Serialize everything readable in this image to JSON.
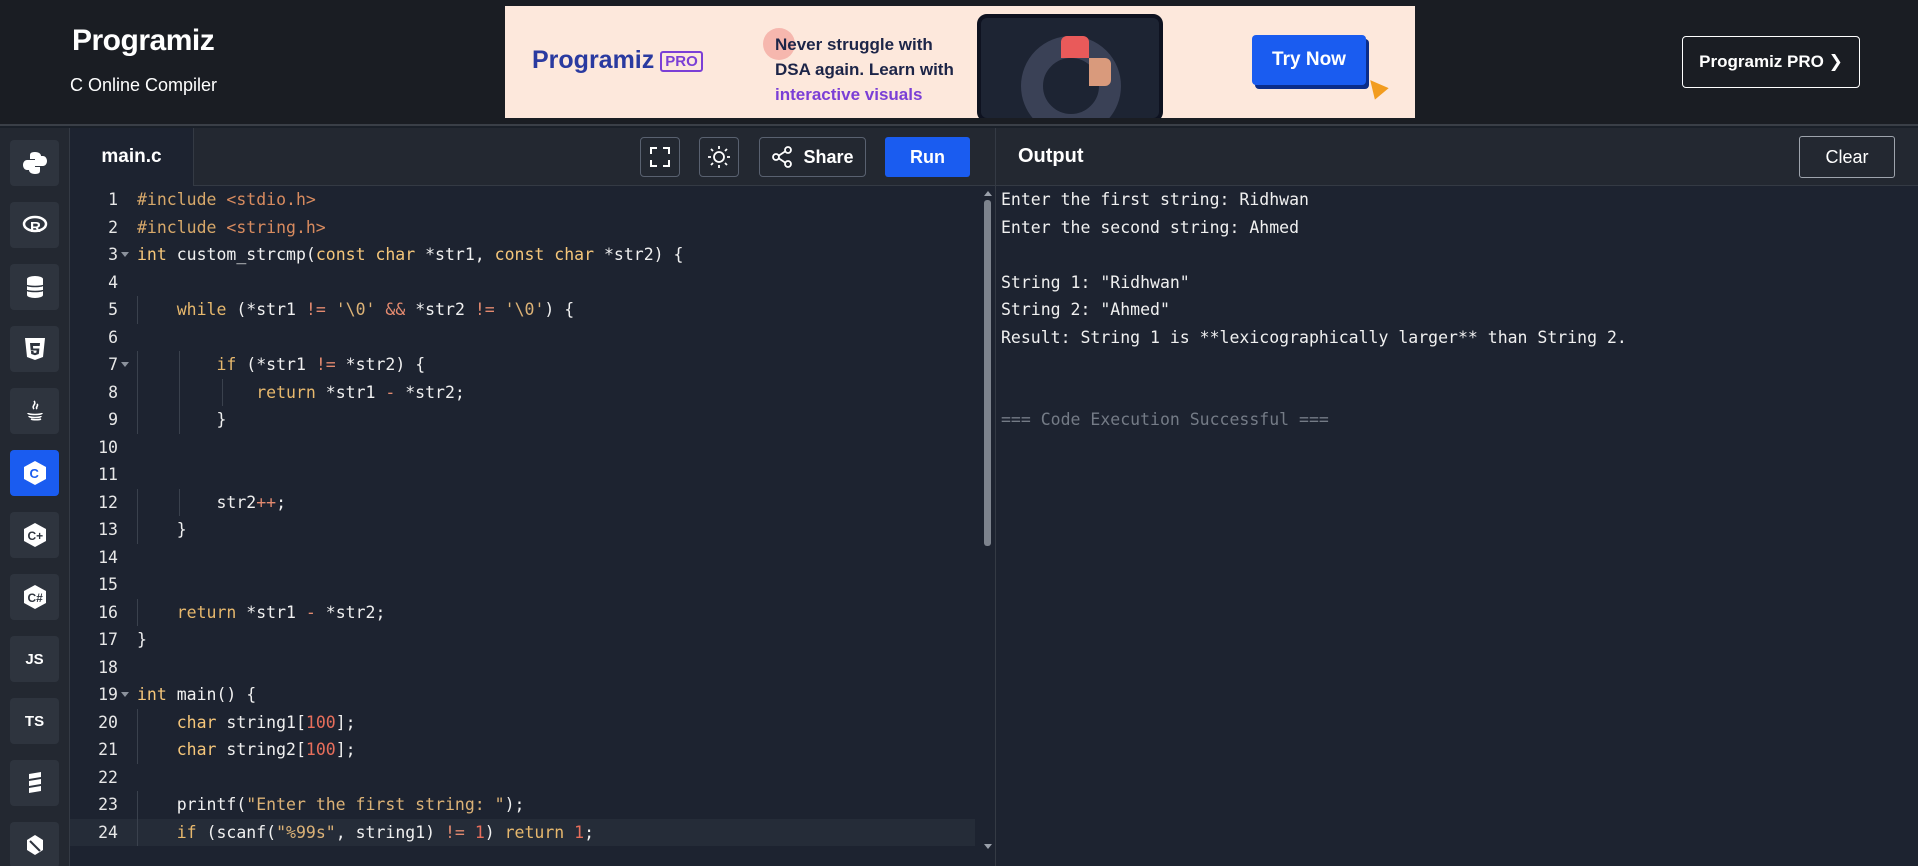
{
  "header": {
    "logo": "Programiz",
    "subtitle": "C Online Compiler",
    "pro_button": "Programiz PRO ❯"
  },
  "ad": {
    "logo": "Programiz",
    "logo_badge": "PRO",
    "line1": "Never struggle with",
    "line2": "DSA again. Learn with",
    "line3": "interactive visuals",
    "cta": "Try Now"
  },
  "sidebar": {
    "items": [
      {
        "name": "python-icon",
        "label": ""
      },
      {
        "name": "r-icon",
        "label": ""
      },
      {
        "name": "sql-icon",
        "label": ""
      },
      {
        "name": "html5-icon",
        "label": ""
      },
      {
        "name": "java-icon",
        "label": ""
      },
      {
        "name": "c-icon",
        "label": "",
        "active": true
      },
      {
        "name": "cpp-icon",
        "label": ""
      },
      {
        "name": "csharp-icon",
        "label": ""
      },
      {
        "name": "js-icon",
        "label": "JS"
      },
      {
        "name": "ts-icon",
        "label": "TS"
      },
      {
        "name": "scala-icon",
        "label": ""
      },
      {
        "name": "dart-icon",
        "label": ""
      }
    ]
  },
  "editor": {
    "tab": "main.c",
    "share_label": "Share",
    "run_label": "Run",
    "lines": [
      {
        "n": "1",
        "code": "#include <stdio.h>"
      },
      {
        "n": "2",
        "code": "#include <string.h>"
      },
      {
        "n": "3",
        "code": "int custom_strcmp(const char *str1, const char *str2) {"
      },
      {
        "n": "4",
        "code": ""
      },
      {
        "n": "5",
        "code": "    while (*str1 != '\\0' && *str2 != '\\0') {"
      },
      {
        "n": "6",
        "code": ""
      },
      {
        "n": "7",
        "code": "        if (*str1 != *str2) {"
      },
      {
        "n": "8",
        "code": "            return *str1 - *str2;"
      },
      {
        "n": "9",
        "code": "        }"
      },
      {
        "n": "10",
        "code": ""
      },
      {
        "n": "11",
        "code": ""
      },
      {
        "n": "12",
        "code": "        str2++;"
      },
      {
        "n": "13",
        "code": "    }"
      },
      {
        "n": "14",
        "code": ""
      },
      {
        "n": "15",
        "code": ""
      },
      {
        "n": "16",
        "code": "    return *str1 - *str2;"
      },
      {
        "n": "17",
        "code": "}"
      },
      {
        "n": "18",
        "code": ""
      },
      {
        "n": "19",
        "code": "int main() {"
      },
      {
        "n": "20",
        "code": "    char string1[100];"
      },
      {
        "n": "21",
        "code": "    char string2[100];"
      },
      {
        "n": "22",
        "code": ""
      },
      {
        "n": "23",
        "code": "    printf(\"Enter the first string: \");"
      },
      {
        "n": "24",
        "code": "    if (scanf(\"%99s\", string1) != 1) return 1;"
      }
    ]
  },
  "output": {
    "title": "Output",
    "clear_label": "Clear",
    "lines": [
      "Enter the first string: Ridhwan",
      "Enter the second string: Ahmed",
      "",
      "String 1: \"Ridhwan\"",
      "String 2: \"Ahmed\"",
      "Result: String 1 is **lexicographically larger** than String 2.",
      "",
      ""
    ],
    "status": "=== Code Execution Successful ==="
  }
}
